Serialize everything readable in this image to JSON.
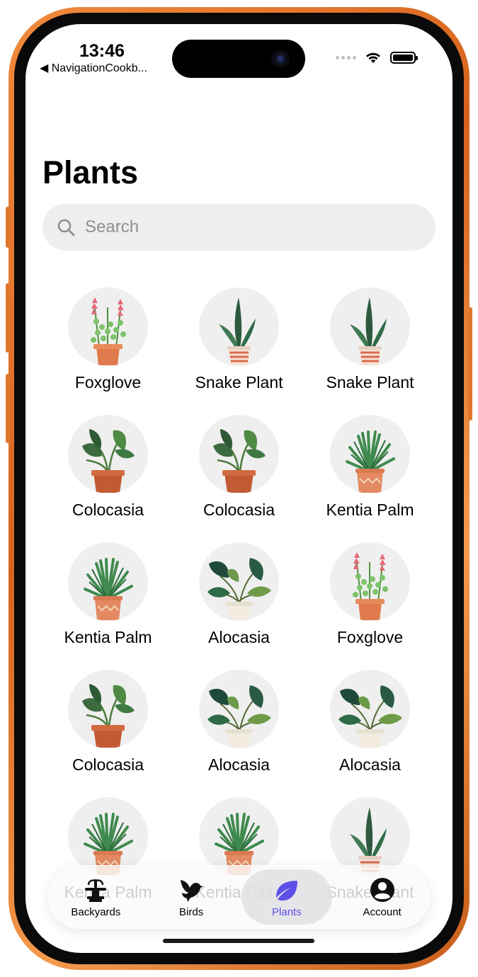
{
  "status": {
    "time": "13:46",
    "back_app": "◀ NavigationCookb..."
  },
  "page": {
    "title": "Plants"
  },
  "search": {
    "placeholder": "Search"
  },
  "plants": [
    {
      "name": "Foxglove",
      "kind": "foxglove"
    },
    {
      "name": "Snake Plant",
      "kind": "snake"
    },
    {
      "name": "Snake Plant",
      "kind": "snake"
    },
    {
      "name": "Colocasia",
      "kind": "colocasia"
    },
    {
      "name": "Colocasia",
      "kind": "colocasia"
    },
    {
      "name": "Kentia Palm",
      "kind": "kentia"
    },
    {
      "name": "Kentia Palm",
      "kind": "kentia"
    },
    {
      "name": "Alocasia",
      "kind": "alocasia"
    },
    {
      "name": "Foxglove",
      "kind": "foxglove"
    },
    {
      "name": "Colocasia",
      "kind": "colocasia"
    },
    {
      "name": "Alocasia",
      "kind": "alocasia"
    },
    {
      "name": "Alocasia",
      "kind": "alocasia"
    },
    {
      "name": "Kentia Palm",
      "kind": "kentia"
    },
    {
      "name": "Kentia Palm",
      "kind": "kentia"
    },
    {
      "name": "Snake Plant",
      "kind": "snake"
    }
  ],
  "tabbar": {
    "tabs": [
      {
        "label": "Backyards",
        "icon": "fountain-icon"
      },
      {
        "label": "Birds",
        "icon": "bird-icon"
      },
      {
        "label": "Plants",
        "icon": "leaf-icon",
        "selected": true
      },
      {
        "label": "Account",
        "icon": "account-icon"
      }
    ],
    "accent": "#5b50e8"
  },
  "colors": {
    "frame": "#e0762c",
    "circle_bg": "#efefef",
    "search_bg": "#eeeeee"
  }
}
